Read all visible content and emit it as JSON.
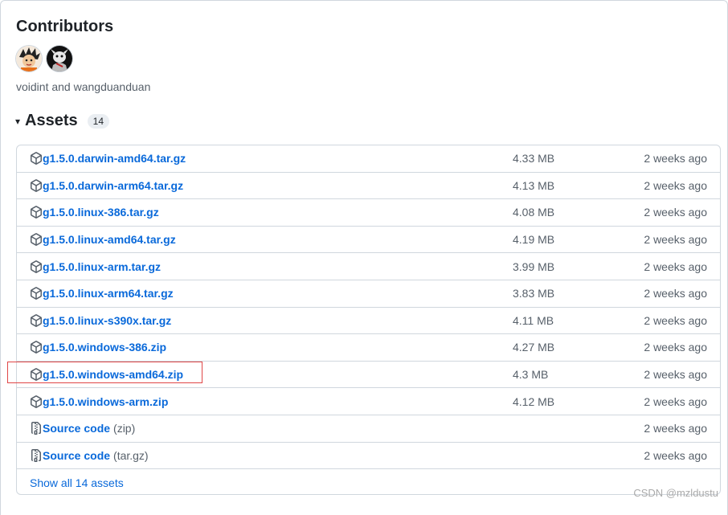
{
  "contributors": {
    "title": "Contributors",
    "avatars": [
      "avatar-voidint",
      "avatar-wangduanduan"
    ],
    "names_text": "voidint and wangduanduan"
  },
  "assets": {
    "caret": "▾",
    "title": "Assets",
    "count": "14",
    "items": [
      {
        "name": "g1.5.0.darwin-amd64.tar.gz",
        "suffix": "",
        "size": "4.33 MB",
        "date": "2 weeks ago",
        "icon": "package-icon"
      },
      {
        "name": "g1.5.0.darwin-arm64.tar.gz",
        "suffix": "",
        "size": "4.13 MB",
        "date": "2 weeks ago",
        "icon": "package-icon"
      },
      {
        "name": "g1.5.0.linux-386.tar.gz",
        "suffix": "",
        "size": "4.08 MB",
        "date": "2 weeks ago",
        "icon": "package-icon"
      },
      {
        "name": "g1.5.0.linux-amd64.tar.gz",
        "suffix": "",
        "size": "4.19 MB",
        "date": "2 weeks ago",
        "icon": "package-icon"
      },
      {
        "name": "g1.5.0.linux-arm.tar.gz",
        "suffix": "",
        "size": "3.99 MB",
        "date": "2 weeks ago",
        "icon": "package-icon"
      },
      {
        "name": "g1.5.0.linux-arm64.tar.gz",
        "suffix": "",
        "size": "3.83 MB",
        "date": "2 weeks ago",
        "icon": "package-icon"
      },
      {
        "name": "g1.5.0.linux-s390x.tar.gz",
        "suffix": "",
        "size": "4.11 MB",
        "date": "2 weeks ago",
        "icon": "package-icon"
      },
      {
        "name": "g1.5.0.windows-386.zip",
        "suffix": "",
        "size": "4.27 MB",
        "date": "2 weeks ago",
        "icon": "package-icon"
      },
      {
        "name": "g1.5.0.windows-amd64.zip",
        "suffix": "",
        "size": "4.3 MB",
        "date": "2 weeks ago",
        "icon": "package-icon"
      },
      {
        "name": "g1.5.0.windows-arm.zip",
        "suffix": "",
        "size": "4.12 MB",
        "date": "2 weeks ago",
        "icon": "package-icon"
      },
      {
        "name": "Source code",
        "suffix": "(zip)",
        "size": "",
        "date": "2 weeks ago",
        "icon": "file-zip-icon"
      },
      {
        "name": "Source code",
        "suffix": "(tar.gz)",
        "size": "",
        "date": "2 weeks ago",
        "icon": "file-zip-icon"
      }
    ],
    "show_all": "Show all 14 assets"
  },
  "watermark": "CSDN @mzldustu",
  "colors": {
    "link": "#0969da",
    "muted": "#57606a",
    "border": "#d0d7de",
    "highlight": "#e04646"
  }
}
